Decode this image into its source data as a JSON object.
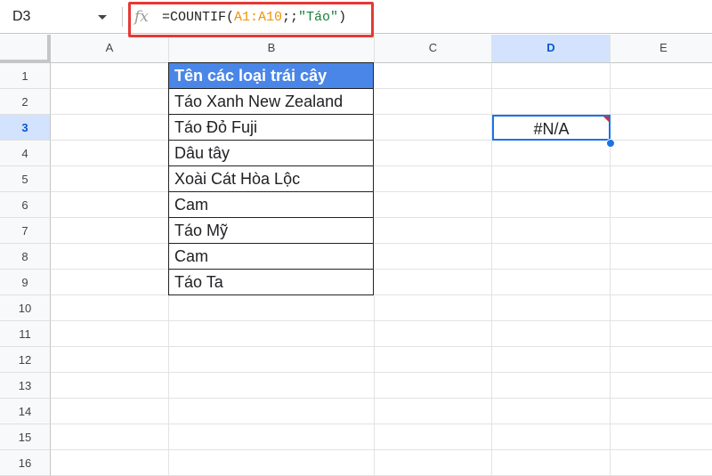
{
  "name_box": "D3",
  "formula": {
    "prefix": "=COUNTIF(",
    "range": "A1:A10",
    "sep": ";;",
    "string": "\"Táo\"",
    "suffix": ")"
  },
  "columns": [
    "A",
    "B",
    "C",
    "D",
    "E"
  ],
  "rows": [
    "1",
    "2",
    "3",
    "4",
    "5",
    "6",
    "7",
    "8",
    "9",
    "10",
    "11",
    "12",
    "13",
    "14",
    "15",
    "16"
  ],
  "selected": {
    "column": "D",
    "row": "3"
  },
  "table_header": "Tên các loại trái cây",
  "fruits": [
    "Táo Xanh New Zealand",
    "Táo Đỏ Fuji",
    "Dâu tây",
    "Xoài Cát Hòa Lộc",
    "Cam",
    "Táo Mỹ",
    "Cam",
    "Táo Ta"
  ],
  "d3_value": "#N/A",
  "colors": {
    "header_fill": "#4a86e8",
    "selection": "#1a73e8",
    "highlight_box": "#e53935"
  }
}
